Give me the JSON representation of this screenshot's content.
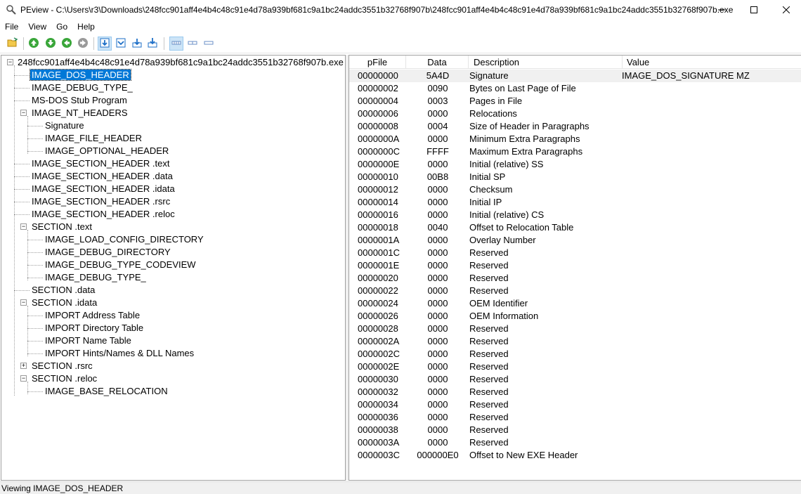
{
  "window": {
    "title": "PEview - C:\\Users\\r3\\Downloads\\248fcc901aff4e4b4c48c91e4d78a939bf681c9a1bc24addc3551b32768f907b\\248fcc901aff4e4b4c48c91e4d78a939bf681c9a1bc24addc3551b32768f907b.exe",
    "icon": "magnifier-icon",
    "controls": [
      "minimize-icon",
      "maximize-icon",
      "close-icon"
    ]
  },
  "menu": [
    "File",
    "View",
    "Go",
    "Help"
  ],
  "toolbar": {
    "buttons": [
      "open-icon",
      "go-up-icon",
      "go-down-icon",
      "back-icon",
      "forward-icon",
      "view-raw-icon",
      "view-details-icon",
      "view-export-icon",
      "view-import-icon",
      "view-bytes-icon",
      "view-words-icon",
      "view-dwords-icon"
    ],
    "active": [
      "view-raw-icon",
      "view-bytes-icon"
    ],
    "colors": {
      "green": "#3aa63a",
      "gray": "#9a9a9a",
      "blue": "#1e6fc7"
    }
  },
  "tree": {
    "root": "248fcc901aff4e4b4c48c91e4d78a939bf681c9a1bc24addc3551b32768f907b.exe",
    "items": [
      {
        "label": "IMAGE_DOS_HEADER",
        "level": 1,
        "selected": true
      },
      {
        "label": "IMAGE_DEBUG_TYPE_",
        "level": 1
      },
      {
        "label": "MS-DOS Stub Program",
        "level": 1
      },
      {
        "label": "IMAGE_NT_HEADERS",
        "level": 1,
        "expander": "minus"
      },
      {
        "label": "Signature",
        "level": 2
      },
      {
        "label": "IMAGE_FILE_HEADER",
        "level": 2
      },
      {
        "label": "IMAGE_OPTIONAL_HEADER",
        "level": 2
      },
      {
        "label": "IMAGE_SECTION_HEADER .text",
        "level": 1
      },
      {
        "label": "IMAGE_SECTION_HEADER .data",
        "level": 1
      },
      {
        "label": "IMAGE_SECTION_HEADER .idata",
        "level": 1
      },
      {
        "label": "IMAGE_SECTION_HEADER .rsrc",
        "level": 1
      },
      {
        "label": "IMAGE_SECTION_HEADER .reloc",
        "level": 1
      },
      {
        "label": "SECTION .text",
        "level": 1,
        "expander": "minus"
      },
      {
        "label": "IMAGE_LOAD_CONFIG_DIRECTORY",
        "level": 2
      },
      {
        "label": "IMAGE_DEBUG_DIRECTORY",
        "level": 2
      },
      {
        "label": "IMAGE_DEBUG_TYPE_CODEVIEW",
        "level": 2
      },
      {
        "label": "IMAGE_DEBUG_TYPE_",
        "level": 2
      },
      {
        "label": "SECTION .data",
        "level": 1
      },
      {
        "label": "SECTION .idata",
        "level": 1,
        "expander": "minus"
      },
      {
        "label": "IMPORT Address Table",
        "level": 2
      },
      {
        "label": "IMPORT Directory Table",
        "level": 2
      },
      {
        "label": "IMPORT Name Table",
        "level": 2
      },
      {
        "label": "IMPORT Hints/Names & DLL Names",
        "level": 2
      },
      {
        "label": "SECTION .rsrc",
        "level": 1,
        "expander": "plus"
      },
      {
        "label": "SECTION .reloc",
        "level": 1,
        "expander": "minus"
      },
      {
        "label": "IMAGE_BASE_RELOCATION",
        "level": 2
      }
    ]
  },
  "list": {
    "columns": [
      "pFile",
      "Data",
      "Description",
      "Value"
    ],
    "rows": [
      {
        "pFile": "00000000",
        "data": "5A4D",
        "desc": "Signature",
        "value": "IMAGE_DOS_SIGNATURE  MZ"
      },
      {
        "pFile": "00000002",
        "data": "0090",
        "desc": "Bytes on Last Page of File",
        "value": ""
      },
      {
        "pFile": "00000004",
        "data": "0003",
        "desc": "Pages in File",
        "value": ""
      },
      {
        "pFile": "00000006",
        "data": "0000",
        "desc": "Relocations",
        "value": ""
      },
      {
        "pFile": "00000008",
        "data": "0004",
        "desc": "Size of Header in Paragraphs",
        "value": ""
      },
      {
        "pFile": "0000000A",
        "data": "0000",
        "desc": "Minimum Extra Paragraphs",
        "value": ""
      },
      {
        "pFile": "0000000C",
        "data": "FFFF",
        "desc": "Maximum Extra Paragraphs",
        "value": ""
      },
      {
        "pFile": "0000000E",
        "data": "0000",
        "desc": "Initial (relative) SS",
        "value": ""
      },
      {
        "pFile": "00000010",
        "data": "00B8",
        "desc": "Initial SP",
        "value": ""
      },
      {
        "pFile": "00000012",
        "data": "0000",
        "desc": "Checksum",
        "value": ""
      },
      {
        "pFile": "00000014",
        "data": "0000",
        "desc": "Initial IP",
        "value": ""
      },
      {
        "pFile": "00000016",
        "data": "0000",
        "desc": "Initial (relative) CS",
        "value": ""
      },
      {
        "pFile": "00000018",
        "data": "0040",
        "desc": "Offset to Relocation Table",
        "value": ""
      },
      {
        "pFile": "0000001A",
        "data": "0000",
        "desc": "Overlay Number",
        "value": ""
      },
      {
        "pFile": "0000001C",
        "data": "0000",
        "desc": "Reserved",
        "value": ""
      },
      {
        "pFile": "0000001E",
        "data": "0000",
        "desc": "Reserved",
        "value": ""
      },
      {
        "pFile": "00000020",
        "data": "0000",
        "desc": "Reserved",
        "value": ""
      },
      {
        "pFile": "00000022",
        "data": "0000",
        "desc": "Reserved",
        "value": ""
      },
      {
        "pFile": "00000024",
        "data": "0000",
        "desc": "OEM Identifier",
        "value": ""
      },
      {
        "pFile": "00000026",
        "data": "0000",
        "desc": "OEM Information",
        "value": ""
      },
      {
        "pFile": "00000028",
        "data": "0000",
        "desc": "Reserved",
        "value": ""
      },
      {
        "pFile": "0000002A",
        "data": "0000",
        "desc": "Reserved",
        "value": ""
      },
      {
        "pFile": "0000002C",
        "data": "0000",
        "desc": "Reserved",
        "value": ""
      },
      {
        "pFile": "0000002E",
        "data": "0000",
        "desc": "Reserved",
        "value": ""
      },
      {
        "pFile": "00000030",
        "data": "0000",
        "desc": "Reserved",
        "value": ""
      },
      {
        "pFile": "00000032",
        "data": "0000",
        "desc": "Reserved",
        "value": ""
      },
      {
        "pFile": "00000034",
        "data": "0000",
        "desc": "Reserved",
        "value": ""
      },
      {
        "pFile": "00000036",
        "data": "0000",
        "desc": "Reserved",
        "value": ""
      },
      {
        "pFile": "00000038",
        "data": "0000",
        "desc": "Reserved",
        "value": ""
      },
      {
        "pFile": "0000003A",
        "data": "0000",
        "desc": "Reserved",
        "value": ""
      },
      {
        "pFile": "0000003C",
        "data": "000000E0",
        "desc": "Offset to New EXE Header",
        "value": ""
      }
    ]
  },
  "status": "Viewing IMAGE_DOS_HEADER"
}
